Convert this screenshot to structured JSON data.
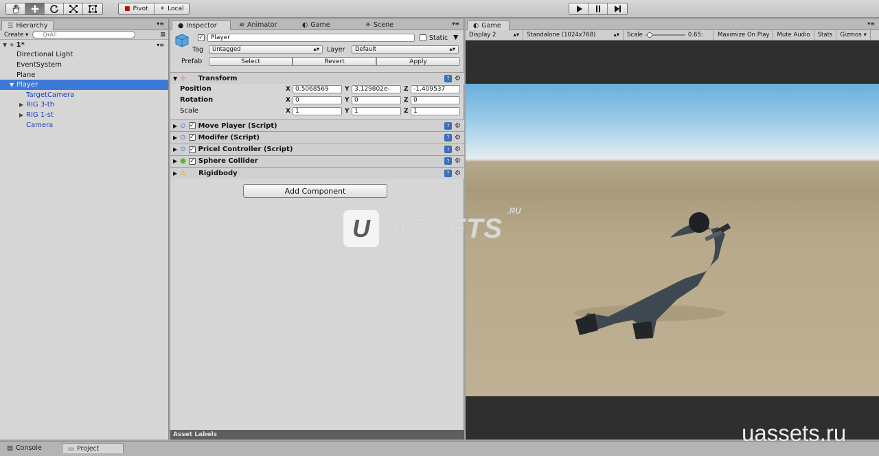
{
  "toolbar": {
    "tools": [
      {
        "name": "hand-tool",
        "icon": "hand-icon",
        "active": false
      },
      {
        "name": "move-tool",
        "icon": "move-icon",
        "active": true
      },
      {
        "name": "rotate-tool",
        "icon": "rotate-icon",
        "active": false
      },
      {
        "name": "scale-tool",
        "icon": "scale-icon",
        "active": false
      },
      {
        "name": "rect-tool",
        "icon": "rect-icon",
        "active": false
      }
    ],
    "pivot_label": "Pivot",
    "local_label": "Local",
    "play_icon": "play-icon",
    "pause_icon": "pause-icon",
    "step_icon": "step-icon"
  },
  "hierarchy": {
    "tab_label": "Hierarchy",
    "create_label": "Create",
    "search_placeholder": "Q▾All",
    "scene_name": "1*",
    "items": [
      {
        "label": "Directional Light",
        "indent": 1,
        "style": "normal",
        "arrow": ""
      },
      {
        "label": "EventSystem",
        "indent": 1,
        "style": "normal",
        "arrow": ""
      },
      {
        "label": "Plane",
        "indent": 1,
        "style": "normal",
        "arrow": ""
      },
      {
        "label": "Player",
        "indent": 1,
        "style": "selected",
        "arrow": "▼"
      },
      {
        "label": "TargetCamera",
        "indent": 2,
        "style": "blue",
        "arrow": ""
      },
      {
        "label": "RIG 3-th",
        "indent": 2,
        "style": "blue",
        "arrow": "▶"
      },
      {
        "label": "RIG 1-st",
        "indent": 2,
        "style": "blue",
        "arrow": "▶"
      },
      {
        "label": "Camera",
        "indent": 2,
        "style": "blue",
        "arrow": ""
      }
    ]
  },
  "inspector": {
    "tabs": [
      "Inspector",
      "Animator",
      "Game",
      "Scene"
    ],
    "object_name": "Player",
    "static_label": "Static",
    "tag_label": "Tag",
    "tag_value": "Untagged",
    "layer_label": "Layer",
    "layer_value": "Default",
    "prefab_label": "Prefab",
    "prefab_select": "Select",
    "prefab_revert": "Revert",
    "prefab_apply": "Apply",
    "transform": {
      "title": "Transform",
      "rows": [
        {
          "label": "Position",
          "x": "0.5068569",
          "y": "3.129802e-",
          "z": "-1.409537"
        },
        {
          "label": "Rotation",
          "x": "0",
          "y": "0",
          "z": "0"
        },
        {
          "label": "Scale",
          "x": "1",
          "y": "1",
          "z": "1"
        }
      ]
    },
    "components": [
      {
        "name": "Move Player (Script)",
        "icon": "script-icon",
        "checked": true
      },
      {
        "name": "Modifer (Script)",
        "icon": "script-icon",
        "checked": true
      },
      {
        "name": "Pricel Controller (Script)",
        "icon": "script-icon",
        "checked": true
      },
      {
        "name": "Sphere Collider",
        "icon": "sphere-collider-icon",
        "checked": true
      },
      {
        "name": "Rigidbody",
        "icon": "rigidbody-icon",
        "checked": false
      }
    ],
    "add_component": "Add Component",
    "asset_labels": "Asset Labels"
  },
  "game": {
    "tab_label": "Game",
    "display": "Display 2",
    "resolution": "Standalone (1024x768)",
    "scale_label": "Scale",
    "scale_value": "0.65:",
    "scale_level": 0.65,
    "maximize": "Maximize On Play",
    "mute": "Mute Audio",
    "stats": "Stats",
    "gizmos": "Gizmos"
  },
  "watermark": {
    "u": "U",
    "text": "ASSETS",
    "ru": ".RU",
    "url": "uassets.ru"
  },
  "bottom": {
    "tabs": [
      "Console",
      "Project"
    ]
  }
}
